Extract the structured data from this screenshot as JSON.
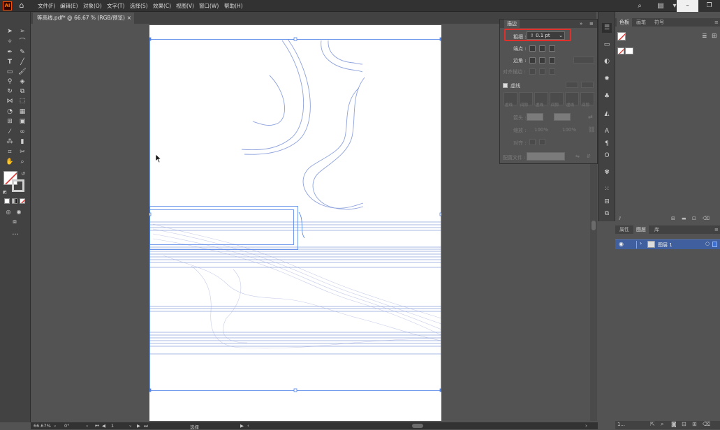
{
  "menubar": {
    "logo": "Ai",
    "items": [
      "文件(F)",
      "编辑(E)",
      "对象(O)",
      "文字(T)",
      "选择(S)",
      "效果(C)",
      "视图(V)",
      "窗口(W)",
      "帮助(H)"
    ]
  },
  "document_tab": {
    "title": "等高线.pdf* @ 66.67 % (RGB/预览)",
    "close": "×"
  },
  "stroke_panel": {
    "title": "描边",
    "weight_label": "粗细 :",
    "weight_value": "0.1 pt",
    "cap_label": "端点 :",
    "corner_label": "边角 :",
    "align_label": "对齐描边 :",
    "dashed_label": "虚线",
    "dash_cells": [
      "虚线",
      "间隙",
      "虚线",
      "间隙",
      "虚线",
      "间隙"
    ],
    "arrow_label": "箭头 :",
    "scale_label": "缩放 :",
    "scale_value_1": "100%",
    "scale_value_2": "100%",
    "align_arrow_label": "对齐 :",
    "profile_label": "配置文件 :"
  },
  "right_panel": {
    "top_tabs": [
      "色板",
      "画笔",
      "符号"
    ],
    "bottom_tabs": [
      "属性",
      "图层",
      "库"
    ],
    "layer_name": "图层 1"
  },
  "statusbar": {
    "zoom": "66.67%",
    "rotate": "0°",
    "artboard_num": "1",
    "tool": "选择"
  },
  "right_status": {
    "layers": "1..."
  },
  "colors": {
    "accent": "#e0302b",
    "contour": "#8ea2dd",
    "selection": "#4f83e8",
    "chrome": "#535353",
    "layer_row": "#3f5f9e"
  },
  "icons": {
    "home": "home-icon",
    "search": "search-icon",
    "arrange": "arrange-documents-icon",
    "workspace": "workspace-icon"
  }
}
